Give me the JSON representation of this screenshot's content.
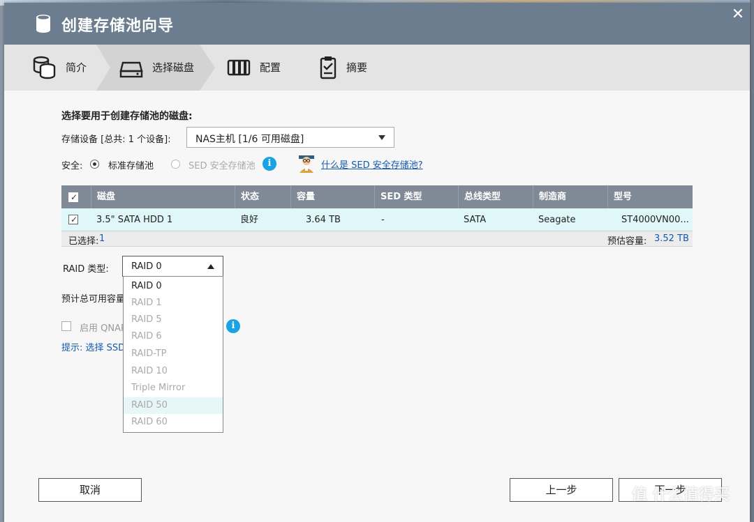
{
  "window": {
    "title": "创建存储池向导",
    "close_glyph": "✕"
  },
  "steps": [
    {
      "label": "简介",
      "icon": "database-icon"
    },
    {
      "label": "选择磁盘",
      "icon": "hdd-icon"
    },
    {
      "label": "配置",
      "icon": "raid-icon"
    },
    {
      "label": "摘要",
      "icon": "clipboard-icon"
    }
  ],
  "content": {
    "heading": "选择要用于创建存储池的磁盘:",
    "device_label": "存储设备 [总共: 1 个设备]:",
    "device_value": "NAS主机 [1/6 可用磁盘]",
    "security_label": "安全:",
    "radio_standard": "标准存储池",
    "radio_sed": "SED 安全存储池",
    "sed_link": "什么是 SED 安全存储池?",
    "table": {
      "headers": [
        "",
        "磁盘",
        "状态",
        "容量",
        "SED 类型",
        "总线类型",
        "制造商",
        "型号"
      ],
      "rows": [
        [
          "",
          "3.5\" SATA HDD 1",
          "良好",
          "3.64 TB",
          "-",
          "SATA",
          "Seagate",
          "ST4000VN00..."
        ]
      ],
      "selected_label": "已选择:",
      "selected_count": "1",
      "estimate_label": "预估容量:",
      "estimate_value": "3.52 TB"
    },
    "raid_label": "RAID 类型:",
    "raid_value": "RAID 0",
    "raid_options": [
      "RAID 0",
      "RAID 1",
      "RAID 5",
      "RAID 6",
      "RAID-TP",
      "RAID 10",
      "Triple Mirror",
      "RAID 50",
      "RAID 60"
    ],
    "est_total_label": "预计总可用容量",
    "qnap_label": "启用 QNAP",
    "hint_label": "提示: 选择 SSD"
  },
  "buttons": {
    "cancel": "取消",
    "prev": "上一步",
    "next": "下一步"
  },
  "watermark": "值 什么值得买",
  "colors": {
    "titlebar": "#6b7d8f",
    "table_header": "#7f8a96",
    "selected_row": "#dff7f8",
    "info_blue": "#1aa2e6",
    "link_blue": "#1558b0"
  }
}
